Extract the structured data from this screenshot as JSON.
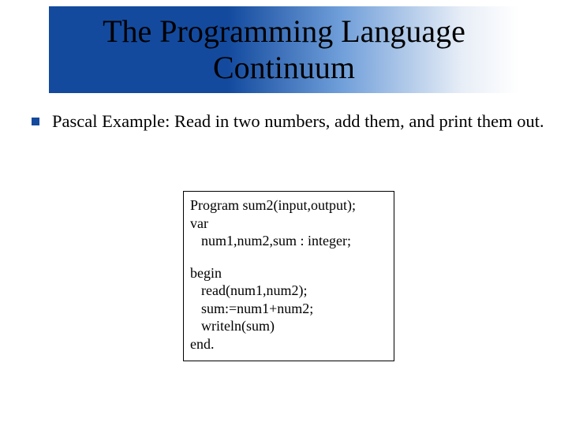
{
  "title": "The Programming Language Continuum",
  "bullet": "Pascal Example: Read in two numbers, add them, and print them out.",
  "code": {
    "l1": "Program sum2(input,output);",
    "l2": "var",
    "l3": "num1,num2,sum : integer;",
    "l4": "begin",
    "l5": "read(num1,num2);",
    "l6": "sum:=num1+num2;",
    "l7": "writeln(sum)",
    "l8": "end."
  }
}
